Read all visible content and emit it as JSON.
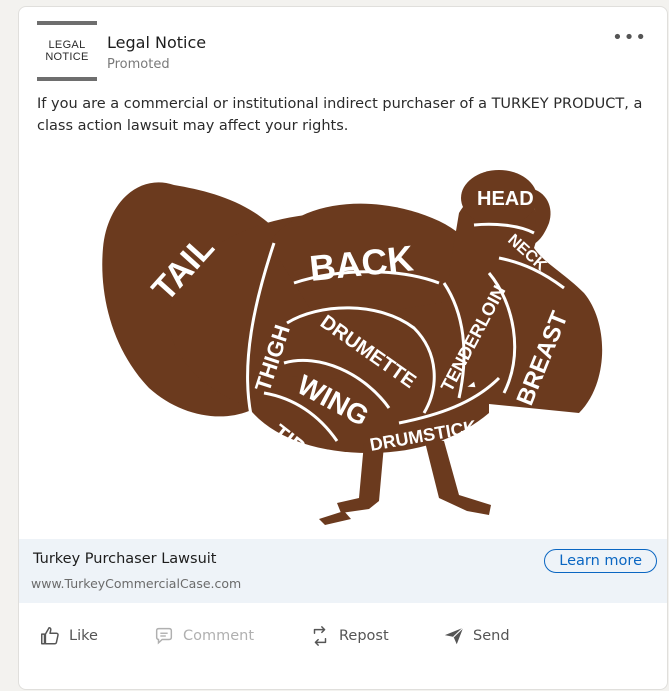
{
  "post": {
    "logo_line1": "LEGAL",
    "logo_line2": "NOTICE",
    "advertiser": "Legal Notice",
    "promoted": "Promoted",
    "more_icon": "ellipsis-icon",
    "body_text": "If you are a commercial or institutional indirect purchaser of a TURKEY PRODUCT, a class action lawsuit may affect your rights."
  },
  "image": {
    "turkey_color": "#6b3a1e",
    "label_color": "#ffffff",
    "labels": {
      "head": "HEAD",
      "neck": "NECK",
      "tail": "TAIL",
      "back": "BACK",
      "thigh": "THIGH",
      "drumette": "DRUMETTE",
      "tenderloin": "TENDERLOIN",
      "breast": "BREAST",
      "wing": "WING",
      "tip": "TIP",
      "drumstick": "DRUMSTICK"
    }
  },
  "link": {
    "title": "Turkey Purchaser Lawsuit",
    "url": "www.TurkeyCommercialCase.com",
    "cta": "Learn more",
    "accent": "#0a66c2"
  },
  "actions": [
    {
      "label": "Like",
      "icon": "thumbs-up-icon"
    },
    {
      "label": "Comment",
      "icon": "comment-icon"
    },
    {
      "label": "Repost",
      "icon": "repost-icon"
    },
    {
      "label": "Send",
      "icon": "send-icon"
    }
  ]
}
